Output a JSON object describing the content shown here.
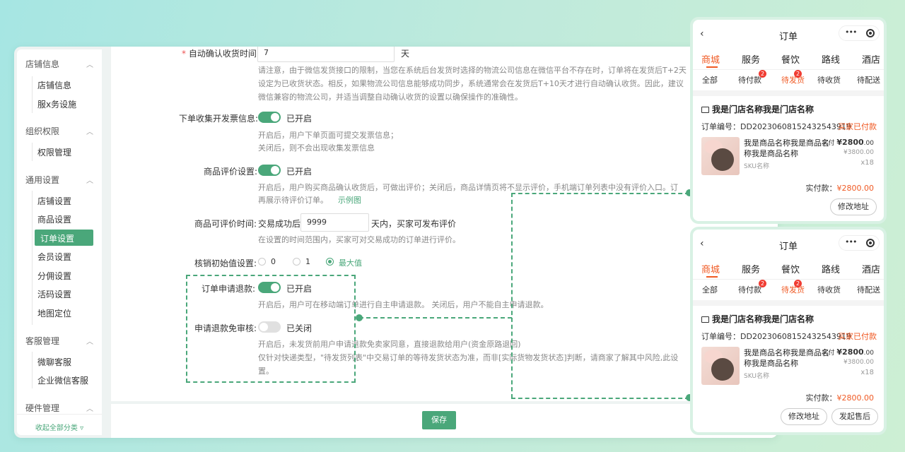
{
  "sidebar": {
    "groups": [
      {
        "label": "店铺信息",
        "items": [
          "店铺信息",
          "服x务设施"
        ]
      },
      {
        "label": "组织权限",
        "items": [
          "权限管理"
        ]
      },
      {
        "label": "通用设置",
        "items": [
          "店铺设置",
          "商品设置",
          "订单设置",
          "会员设置",
          "分佣设置",
          "活码设置",
          "地图定位"
        ]
      },
      {
        "label": "客服管理",
        "items": [
          "微聊客服",
          "企业微信客服"
        ]
      },
      {
        "label": "硬件管理",
        "items": []
      }
    ],
    "active_item": "订单设置",
    "collapse_label": "收起全部分类 ▿"
  },
  "settings": {
    "auto_confirm": {
      "required_mark": "*",
      "label": "自动确认收货时间:",
      "value": "7",
      "unit": "天",
      "help_lines": [
        "请注意，由于微信发货接口的限制，当您在系统后台发货时选择的物流公司信息在微信平台不存在时，订单将在发货后T+2天",
        "设定为已收货状态。相反，如果物流公司信息能够成功同步，系统通常会在发货后T+10天才进行自动确认收货。因此，建议",
        "微信兼容的物流公司，并适当调整自动确认收货的设置以确保操作的准确性。"
      ]
    },
    "invoice": {
      "label": "下单收集开发票信息:",
      "state": "已开启",
      "on": true,
      "help_lines": [
        "开启后，用户下单页面可提交发票信息；",
        "关闭后，则不会出现收集发票信息"
      ]
    },
    "review": {
      "label": "商品评价设置:",
      "state": "已开启",
      "on": true,
      "help_line1": "开启后，用户购买商品确认收货后，可做出评价；关闭后，商品详情页将不显示评价，手机端订单列表中没有评价入口。订",
      "help_line2": "再展示待评价订单。",
      "example_link": "示例图"
    },
    "review_time": {
      "label": "商品可评价时间:",
      "prefix": "交易成功后",
      "value": "9999",
      "suffix": "天内，买家可发布评价",
      "help": "在设置的时间范围内，买家可对交易成功的订单进行评价。"
    },
    "verify_init": {
      "label": "核销初始值设置:",
      "options": [
        "0",
        "1",
        "最大值"
      ],
      "selected": "最大值"
    },
    "refund": {
      "label": "订单申请退款:",
      "state": "已开启",
      "on": true,
      "help": "开启后，用户可在移动端订单进行自主申请退款。 关闭后，用户不能自主申请退款。"
    },
    "refund_no_review": {
      "label": "申请退款免审核:",
      "state": "已关闭",
      "on": false,
      "help_lines": [
        "开启后，未发货前用户申请退款免卖家同意，直接退款给用户(资金原路退回)",
        "仅针对快递类型，\"待发货列表\"中交易订单的等待发货状态为准，而非[实际货物发货状态]判断，请商家了解其中风险,此设",
        "置。"
      ]
    },
    "save_label": "保存"
  },
  "phones": [
    {
      "title": "订单",
      "back": "‹",
      "dots": "•••",
      "tabs": [
        "商城",
        "服务",
        "餐饮",
        "路线",
        "酒店"
      ],
      "active_tab": "商城",
      "subtabs": [
        "全部",
        "待付款",
        "待发货",
        "待收货",
        "待配送"
      ],
      "active_subtab": "待发货",
      "badges": [
        "2",
        "2"
      ],
      "store_name": "我是门店名称我是门店名称",
      "order_no": "订单编号：DD20230608152432543919",
      "order_status": "买家已付款",
      "product_name": "我是商品名称我是商品名称我是商品名称",
      "sku": "SKU名称",
      "pay_prefix": "实付",
      "pay_price": "¥2800",
      "pay_dec": ".00",
      "orig_price": "¥3800.00",
      "qty": "x18",
      "total_label": "实付款：",
      "total_value": "¥2800.00",
      "buttons": [
        "修改地址"
      ]
    },
    {
      "title": "订单",
      "back": "‹",
      "dots": "•••",
      "tabs": [
        "商城",
        "服务",
        "餐饮",
        "路线",
        "酒店"
      ],
      "active_tab": "商城",
      "subtabs": [
        "全部",
        "待付款",
        "待发货",
        "待收货",
        "待配送"
      ],
      "active_subtab": "待发货",
      "badges": [
        "2",
        "2"
      ],
      "store_name": "我是门店名称我是门店名称",
      "order_no": "订单编号：DD20230608152432543919",
      "order_status": "买家已付款",
      "product_name": "我是商品名称我是商品名称我是商品名称",
      "sku": "SKU名称",
      "pay_prefix": "实付",
      "pay_price": "¥2800",
      "pay_dec": ".00",
      "orig_price": "¥3800.00",
      "qty": "x18",
      "total_label": "实付款：",
      "total_value": "¥2800.00",
      "buttons": [
        "修改地址",
        "发起售后"
      ]
    }
  ],
  "colors": {
    "accent": "#4aa77a",
    "orange": "#f05a24",
    "badge": "#f03c32"
  }
}
